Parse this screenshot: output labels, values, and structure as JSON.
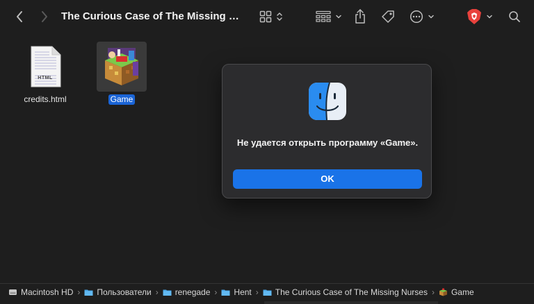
{
  "toolbar": {
    "title": "The Curious Case of The Missing Nurses",
    "back_icon": "chevron-left-icon",
    "forward_icon": "chevron-right-icon",
    "view_icon": "grid-view-icon",
    "group_icon": "group-icon",
    "share_icon": "share-icon",
    "tag_icon": "tag-icon",
    "more_icon": "ellipsis-circle-icon",
    "extension_icon": "brave-shield-icon",
    "search_icon": "search-icon",
    "extension_color": "#e8413c"
  },
  "files": [
    {
      "label": "credits.html",
      "badge": "HTML",
      "selected": false
    },
    {
      "label": "Game",
      "selected": true
    }
  ],
  "dialog": {
    "icon": "finder-icon",
    "message": "Не удается открыть программу «Game».",
    "ok_label": "OK",
    "button_color": "#1a73e8"
  },
  "pathbar": {
    "items": [
      {
        "label": "Macintosh HD",
        "icon": "hard-drive-icon"
      },
      {
        "label": "Пользователи",
        "icon": "folder-icon"
      },
      {
        "label": "renegade",
        "icon": "folder-icon"
      },
      {
        "label": "Hent",
        "icon": "folder-icon"
      },
      {
        "label": "The Curious Case of The Missing Nurses",
        "icon": "folder-icon"
      },
      {
        "label": "Game",
        "icon": "game-app-icon"
      }
    ]
  }
}
